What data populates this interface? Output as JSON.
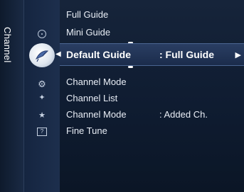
{
  "sidebar": {
    "category_label": "Channel"
  },
  "menu": {
    "items": [
      {
        "label": "Full Guide",
        "value": ""
      },
      {
        "label": "Mini Guide",
        "value": ""
      },
      {
        "label": "Default Guide",
        "value": ": Full Guide"
      },
      {
        "label": "Channel Mode",
        "value": ""
      },
      {
        "label": "Channel List",
        "value": ""
      },
      {
        "label": "Channel Mode",
        "value": ": Added Ch."
      },
      {
        "label": "Fine Tune",
        "value": ""
      }
    ],
    "selected_index": 2
  },
  "icons": [
    "clock-icon",
    "satellite-dish-icon",
    "gear-icon",
    "antenna-icon",
    "favorite-channel-icon",
    "help-icon"
  ],
  "colors": {
    "background": "#16243a",
    "selected_row": "#2a3e63",
    "text": "#e9eef6"
  }
}
